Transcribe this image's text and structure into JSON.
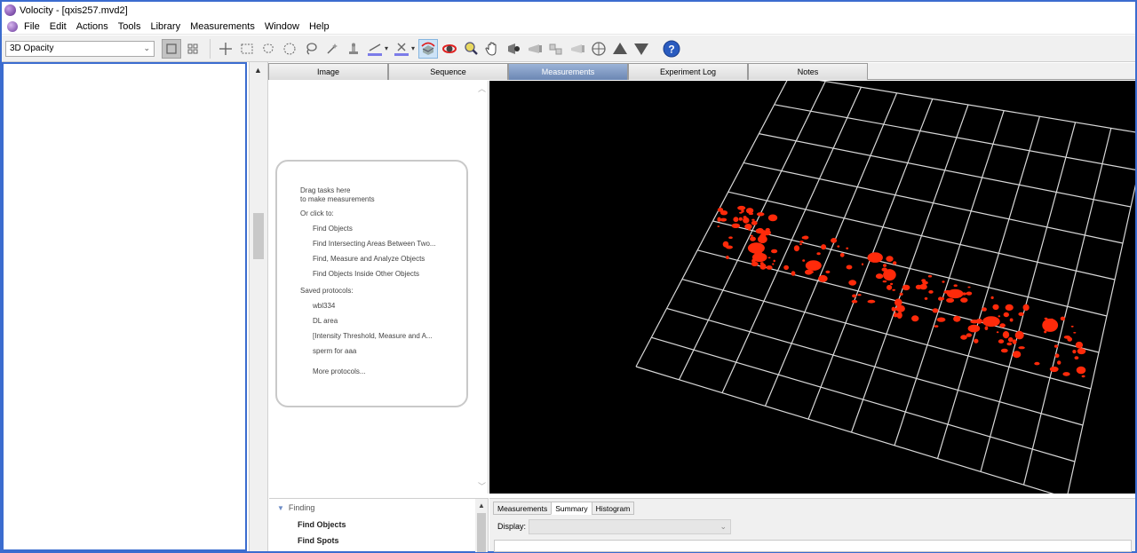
{
  "window": {
    "title": "Volocity - [qxis257.mvd2]"
  },
  "menu": {
    "items": [
      "File",
      "Edit",
      "Actions",
      "Tools",
      "Library",
      "Measurements",
      "Window",
      "Help"
    ]
  },
  "toolbar": {
    "view_mode": "3D Opacity",
    "icons": {
      "view_single": "single-view-icon",
      "view_grid": "grid-view-icon",
      "crosshair": "crosshair-icon",
      "rect_select": "rectangle-select-icon",
      "freehand_select": "freehand-select-icon",
      "ellipse_select": "ellipse-select-icon",
      "lasso": "lasso-icon",
      "magic_wand": "magic-wand-icon",
      "stamp": "stamp-icon",
      "line_tool": "line-tool-icon",
      "point_tool": "point-tool-icon",
      "rotate3d": "rotate-3d-icon",
      "orbit": "orbit-icon",
      "zoom": "zoom-icon",
      "hand": "hand-pan-icon",
      "flythrough": "fly-icon",
      "clip_plane": "clip-plane-icon",
      "light": "light-icon",
      "target": "target-icon",
      "up": "up-arrow-icon",
      "down": "down-arrow-icon",
      "help": "help-icon"
    }
  },
  "tabs": [
    "Image",
    "Sequence",
    "Measurements",
    "Experiment Log",
    "Notes"
  ],
  "active_tab": "Measurements",
  "task_panel": {
    "drag_hint_1": "Drag tasks here",
    "drag_hint_2": "to make measurements",
    "or_click": "Or click to:",
    "actions": [
      "Find Objects",
      "Find Intersecting Areas Between Two...",
      "Find, Measure and Analyze Objects",
      "Find Objects Inside Other Objects"
    ],
    "saved_label": "Saved protocols:",
    "saved": [
      "wbl334",
      "DL area",
      "[Intensity Threshold, Measure and A...",
      "sperm for aaa"
    ],
    "more": "More protocols..."
  },
  "finding_panel": {
    "heading": "Finding",
    "items": [
      "Find Objects",
      "Find Spots"
    ]
  },
  "results_panel": {
    "tabs": [
      "Measurements",
      "Summary",
      "Histogram"
    ],
    "active_tab": "Summary",
    "display_label": "Display:"
  },
  "colors": {
    "accent_border": "#3b6ccf",
    "active_tab": "#6b86b3",
    "object_red": "#ff2a0a",
    "grid_line": "#d8d8d8"
  }
}
